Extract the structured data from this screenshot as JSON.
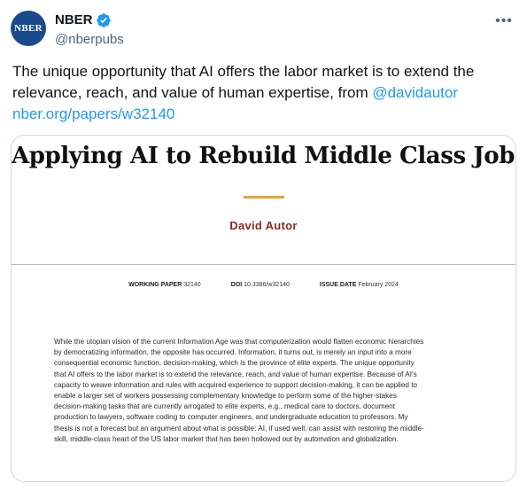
{
  "author": {
    "avatar_text": "NBER",
    "display_name": "NBER",
    "handle": "@nberpubs",
    "verified": true,
    "more_icon": "more-horizontal-icon"
  },
  "tweet": {
    "text": "The unique opportunity that AI offers the labor market is to extend the relevance, reach, and value of human expertise, from ",
    "mention": "@davidautor",
    "link": "nber.org/papers/w32140"
  },
  "paper": {
    "title": "Applying AI to Rebuild Middle Class Jobs",
    "author": "David Autor",
    "working_paper_label": "WORKING PAPER",
    "working_paper_value": "32140",
    "doi_label": "DOI",
    "doi_value": "10.3386/w32140",
    "issue_date_label": "ISSUE DATE",
    "issue_date_value": "February 2024",
    "abstract": [
      "While the utopian vision of the current Information Age was that computerization would flatten economic hierarchies",
      "by democratizing information, the opposite has occurred. Information, it turns out, is merely an input into a more",
      "consequential economic function, decision-making, which is the province of elite experts. The unique opportunity",
      "that AI offers to the labor market is to extend the relevance, reach, and value of human expertise. Because of AI's",
      "capacity to weave information and rules with acquired experience to support decision-making, it can be applied to",
      "enable a larger set of workers possessing complementary knowledge to perform some of the higher-stakes",
      "decision-making tasks that are currently arrogated to elite experts, e.g., medical care to doctors, document",
      "production to lawyers, software coding to computer engineers, and undergraduate education to professors. My",
      "thesis is not a forecast but an argument about what is possible: AI, if used well, can assist with restoring the middle-",
      "skill, middle-class heart of the US labor market that has been hollowed out by automation and globalization."
    ]
  },
  "colors": {
    "link": "#1d9bf0",
    "verified": "#1d9bf0",
    "avatar_bg": "#1a4a8c",
    "author_name": "#8b2a22",
    "accent_rule": "#e8a531"
  }
}
